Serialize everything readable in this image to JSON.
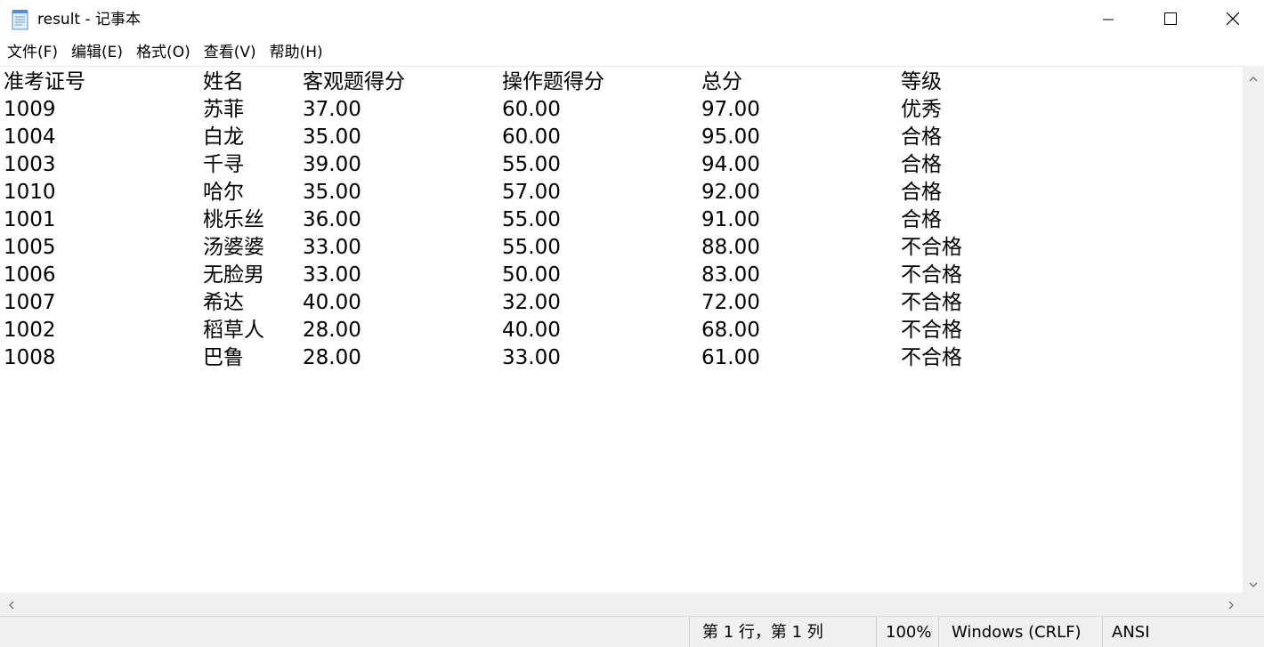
{
  "window": {
    "title": "result - 记事本",
    "icons": {
      "app": "notepad-icon",
      "minimize": "minimize-icon",
      "maximize": "maximize-icon",
      "close": "close-icon"
    }
  },
  "menu": {
    "file": "文件(F)",
    "edit": "编辑(E)",
    "format": "格式(O)",
    "view": "查看(V)",
    "help": "帮助(H)"
  },
  "document": {
    "headers": [
      "准考证号",
      "姓名",
      "客观题得分",
      "操作题得分",
      "总分",
      "等级"
    ],
    "rows": [
      [
        "1009",
        "苏菲",
        "37.00",
        "60.00",
        "97.00",
        "优秀"
      ],
      [
        "1004",
        "白龙",
        "35.00",
        "60.00",
        "95.00",
        "合格"
      ],
      [
        "1003",
        "千寻",
        "39.00",
        "55.00",
        "94.00",
        "合格"
      ],
      [
        "1010",
        "哈尔",
        "35.00",
        "57.00",
        "92.00",
        "合格"
      ],
      [
        "1001",
        "桃乐丝",
        "36.00",
        "55.00",
        "91.00",
        "合格"
      ],
      [
        "1005",
        "汤婆婆",
        "33.00",
        "55.00",
        "88.00",
        "不合格"
      ],
      [
        "1006",
        "无脸男",
        "33.00",
        "50.00",
        "83.00",
        "不合格"
      ],
      [
        "1007",
        "希达",
        "40.00",
        "32.00",
        "72.00",
        "不合格"
      ],
      [
        "1002",
        "稻草人",
        "28.00",
        "40.00",
        "68.00",
        "不合格"
      ],
      [
        "1008",
        "巴鲁",
        "28.00",
        "33.00",
        "61.00",
        "不合格"
      ]
    ]
  },
  "statusbar": {
    "position": "第 1 行，第 1 列",
    "zoom": "100%",
    "line_ending": "Windows (CRLF)",
    "encoding": "ANSI"
  }
}
